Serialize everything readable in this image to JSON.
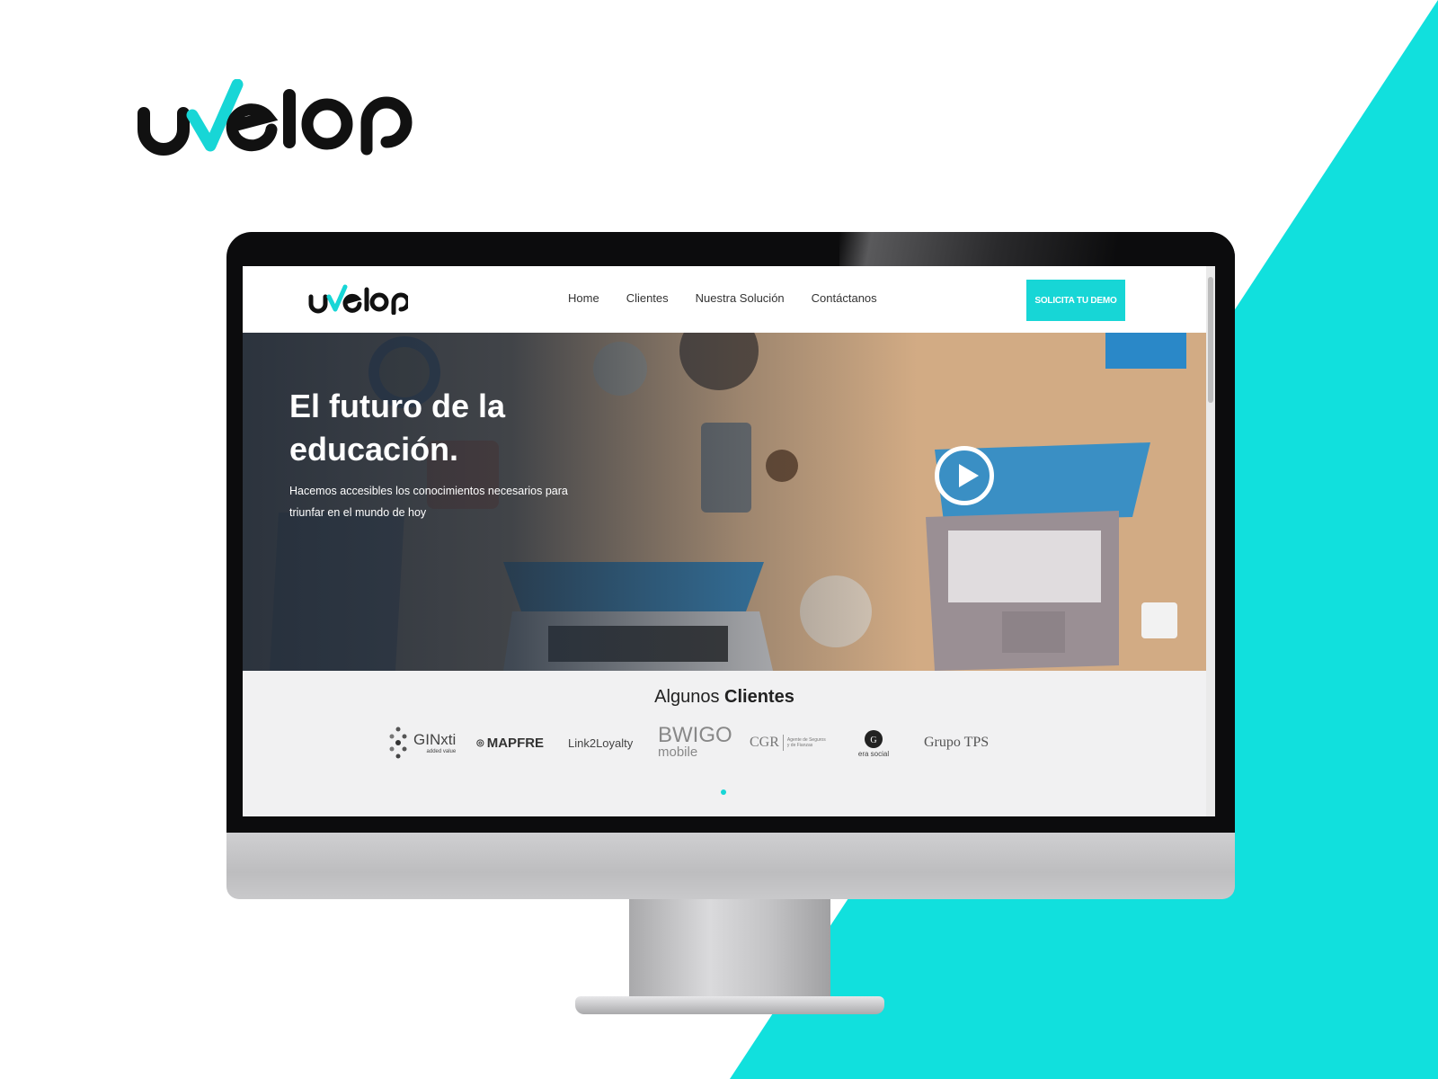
{
  "colors": {
    "accent": "#17d6d6",
    "monitor": "#0c0c0d",
    "text_dark": "#222222"
  },
  "brand": {
    "logo_text": "uvelop"
  },
  "site": {
    "logo_text": "uvelop",
    "nav": [
      "Home",
      "Clientes",
      "Nuestra Solución",
      "Contáctanos"
    ],
    "cta_label": "SOLICITA TU DEMO"
  },
  "hero": {
    "title": "El futuro de la educación.",
    "subtitle": "Hacemos accesibles los conocimientos necesarios para triunfar en el mundo de hoy",
    "play_icon": "play-icon"
  },
  "clients": {
    "title_prefix": "Algunos",
    "title_bold": "Clientes",
    "logos": {
      "ginxti": "GINxti",
      "ginxti_sub": "added value",
      "mapfre": "MAPFRE",
      "link": "Link2Loyalty",
      "bwigo": "BWIGO",
      "bwigo_sub": "mobile",
      "cgr": "CGR",
      "cgr_sub": "Agente de Seguros y de Fianzas",
      "erasocial": "era social",
      "grupotps": "Grupo TPS"
    }
  }
}
